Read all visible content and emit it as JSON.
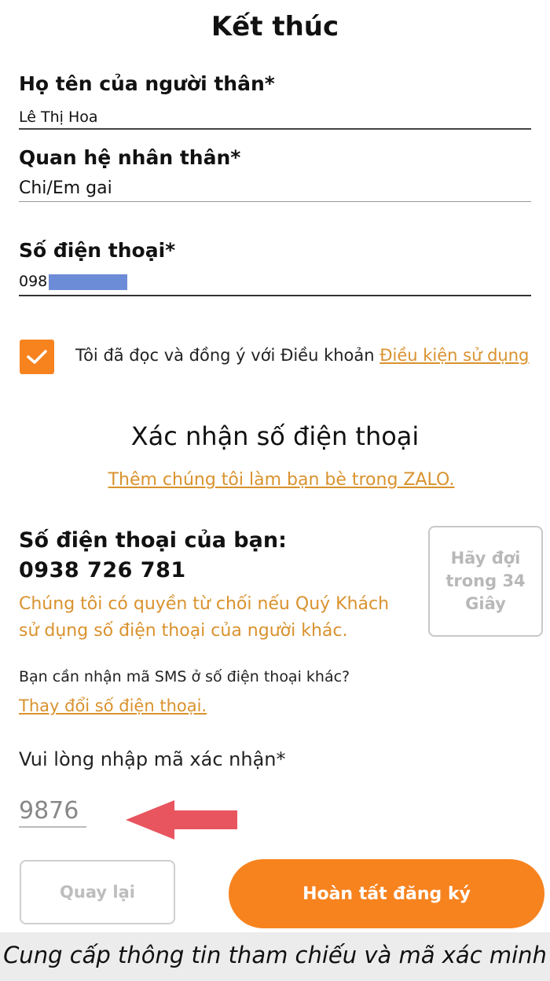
{
  "page": {
    "title": "Kết thúc"
  },
  "form": {
    "relative_name": {
      "label": "Họ tên của người thân*",
      "value": "Lê Thị Hoa"
    },
    "relationship": {
      "label": "Quan hệ nhân thân*",
      "value": "Chi/Em gai"
    },
    "phone": {
      "label": "Số điện thoại*",
      "value": "098"
    }
  },
  "agreement": {
    "checked": true,
    "text": "Tôi đã đọc và đồng ý với Điều khoản ",
    "link": "Điều kiện sử dụng"
  },
  "verify": {
    "title": "Xác nhận số điện thoại",
    "zalo_link": "Thêm chúng tôi làm bạn bè trong ZALO.",
    "your_phone_label": "Số điện thoại của bạn:",
    "your_phone": "0938 726 781",
    "warning": "Chúng tôi có quyền từ chối nếu Quý Khách sử dụng số điện thoại của người khác.",
    "wait_button": "Hãy đợi trong 34 Giây",
    "other_phone_question": "Bạn cần nhận mã SMS ở số điện thoại khác?",
    "change_phone_link": "Thay đổi số điện thoại.",
    "code_label": "Vui lòng nhập mã xác nhận*",
    "code_value": "9876"
  },
  "buttons": {
    "back": "Quay lại",
    "finish": "Hoàn tất đăng ký"
  },
  "caption": "Cung cấp thông tin tham chiếu và mã xác minh",
  "colors": {
    "accent": "#f7831f",
    "link": "#d9922e",
    "arrow": "#e8555f",
    "mask": "#6c8cd8"
  }
}
